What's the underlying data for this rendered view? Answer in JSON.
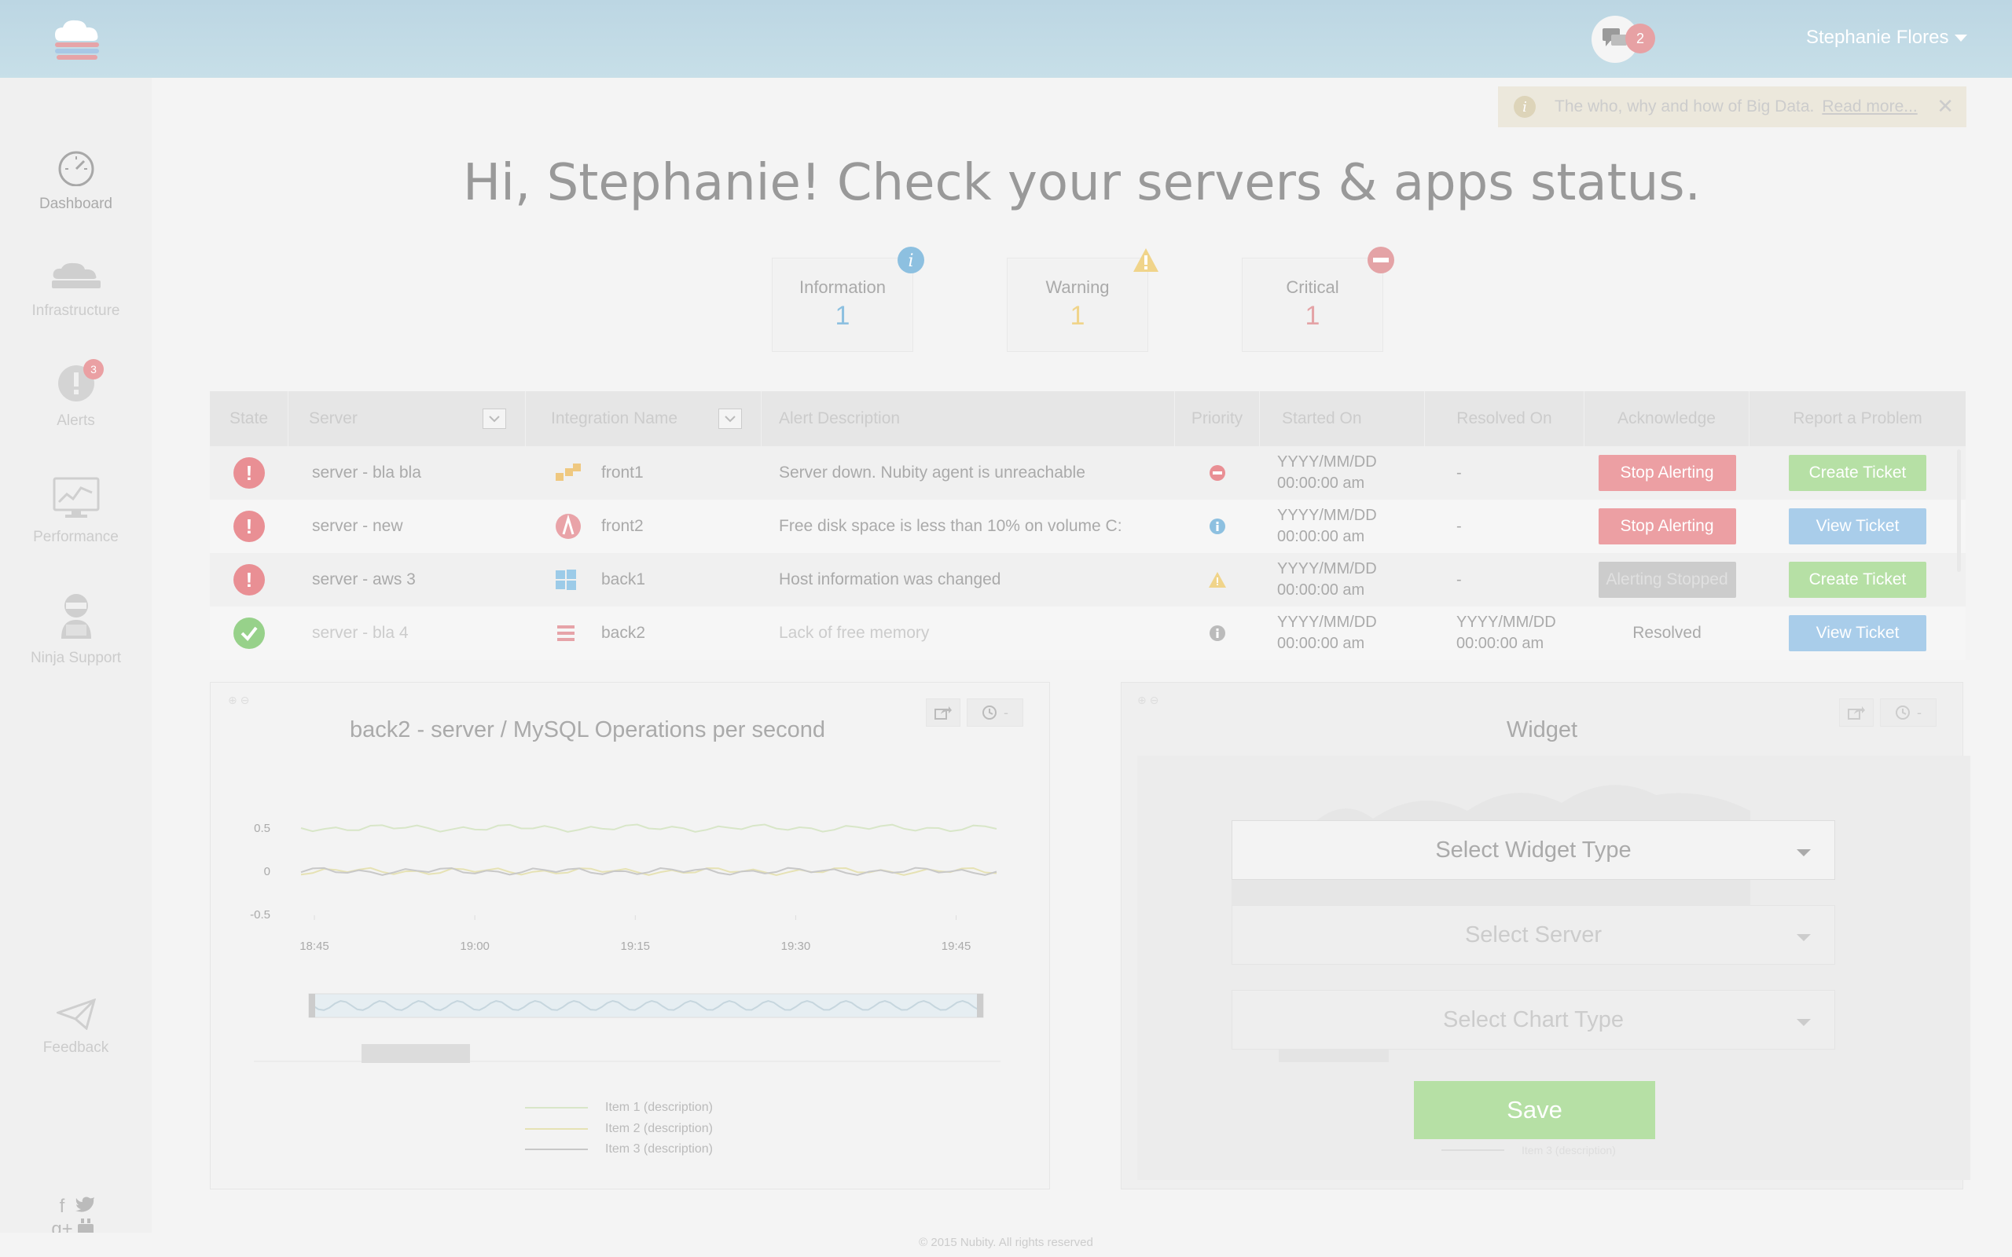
{
  "header": {
    "user_name": "Stephanie Flores",
    "message_count": "2"
  },
  "sidebar": {
    "items": [
      {
        "label": "Dashboard",
        "icon": "speedometer-icon"
      },
      {
        "label": "Infrastructure",
        "icon": "cloud-server-icon"
      },
      {
        "label": "Alerts",
        "icon": "alert-icon",
        "badge": "3"
      },
      {
        "label": "Performance",
        "icon": "monitor-chart-icon"
      },
      {
        "label": "Ninja Support",
        "icon": "ninja-icon"
      },
      {
        "label": "Feedback",
        "icon": "paper-plane-icon"
      }
    ]
  },
  "info_bar": {
    "text": "The who, why and how of Big Data.",
    "link": "Read more...",
    "close": "✕"
  },
  "headline": "Hi, Stephanie! Check your servers & apps status.",
  "stats": [
    {
      "label": "Information",
      "value": "1",
      "color": "#8dc0e0"
    },
    {
      "label": "Warning",
      "value": "1",
      "color": "#f0d48a"
    },
    {
      "label": "Critical",
      "value": "1",
      "color": "#e4a3a6"
    }
  ],
  "table": {
    "headers": [
      "State",
      "Server",
      "Integration Name",
      "Alert Description",
      "Priority",
      "Started On",
      "Resolved On",
      "Acknowledge",
      "Report a Problem"
    ],
    "rows": [
      {
        "server": "server - bla bla",
        "integration": "front1",
        "description": "Server down. Nubity agent is unreachable",
        "started_1": "YYYY/MM/DD",
        "started_2": "00:00:00 am",
        "resolved_1": "-",
        "resolved_2": "",
        "ack": "Stop Alerting",
        "report": "Create Ticket"
      },
      {
        "server": "server - new",
        "integration": "front2",
        "description": "Free disk space is less than 10% on volume C:",
        "started_1": "YYYY/MM/DD",
        "started_2": "00:00:00 am",
        "resolved_1": "-",
        "resolved_2": "",
        "ack": "Stop Alerting",
        "report": "View Ticket"
      },
      {
        "server": "server - aws 3",
        "integration": "back1",
        "description": "Host information was changed",
        "started_1": "YYYY/MM/DD",
        "started_2": "00:00:00 am",
        "resolved_1": "-",
        "resolved_2": "",
        "ack": "Alerting Stopped",
        "report": "Create Ticket"
      },
      {
        "server": "server - bla 4",
        "integration": "back2",
        "description": "Lack of free memory",
        "started_1": "YYYY/MM/DD",
        "started_2": "00:00:00 am",
        "resolved_1": "YYYY/MM/DD",
        "resolved_2": "00:00:00 am",
        "ack": "Resolved",
        "report": "View Ticket"
      }
    ]
  },
  "chart_panel": {
    "title": "back2 - server / MySQL Operations per second",
    "time_label": "-"
  },
  "chart_data": {
    "type": "line",
    "title": "back2 - server / MySQL Operations per second",
    "x_ticks": [
      "18:45",
      "19:00",
      "19:15",
      "19:30",
      "19:45"
    ],
    "y_ticks": [
      "0.5",
      "0",
      "-0.5"
    ],
    "ylim": [
      -0.5,
      0.5
    ],
    "series": [
      {
        "name": "Item 1 (description)",
        "color": "#d8e6c8",
        "level": 0.5
      },
      {
        "name": "Item 2 (description)",
        "color": "#e6e2b4",
        "level": 0.0
      },
      {
        "name": "Item 3 (description)",
        "color": "#c8c8c8",
        "level": 0.0
      }
    ]
  },
  "widget_panel": {
    "title": "Widget",
    "select_type": "Select Widget Type",
    "select_server": "Select Server",
    "select_chart": "Select Chart Type",
    "save": "Save",
    "time_label": "-",
    "legend_ghost": "Item 3 (description)"
  },
  "footer": "© 2015 Nubity. All rights reserved"
}
